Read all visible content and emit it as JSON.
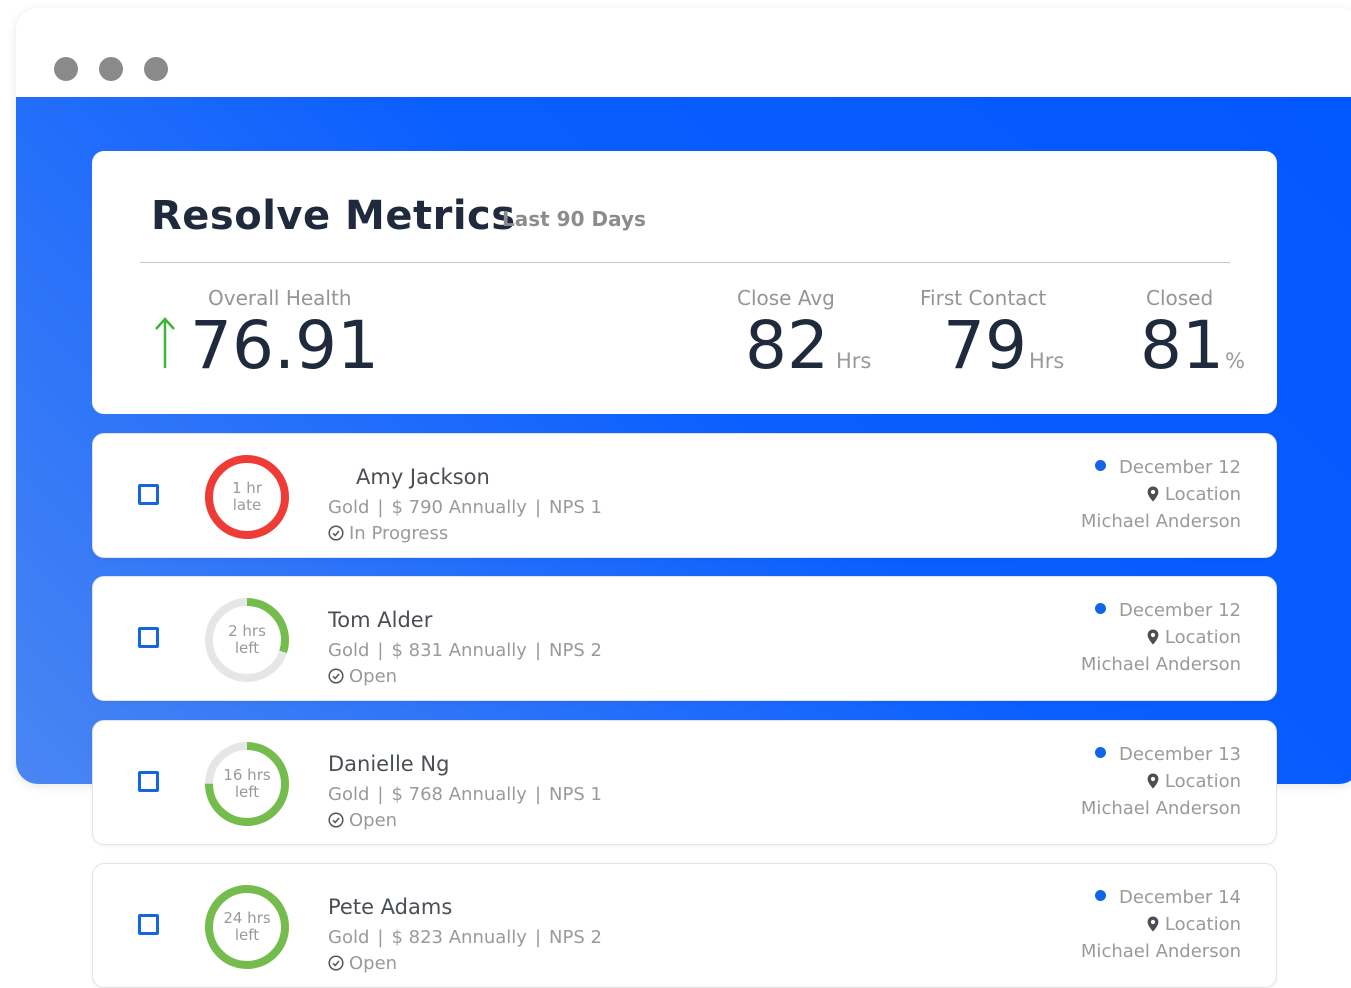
{
  "window": {
    "controls": [
      "window-control-dot",
      "window-control-dot",
      "window-control-dot"
    ]
  },
  "metrics": {
    "title": "Resolve Metrics",
    "range": "Last 90 Days",
    "overall_health": {
      "label": "Overall Health",
      "value": "76.91",
      "trend": "up",
      "trend_color": "#3ab53a"
    },
    "close_avg": {
      "label": "Close Avg",
      "value": "82",
      "unit": "Hrs"
    },
    "first_contact": {
      "label": "First Contact",
      "value": "79",
      "unit": "Hrs"
    },
    "closed": {
      "label": "Closed",
      "value": "81",
      "unit": "%"
    }
  },
  "tickets": [
    {
      "name": "Amy Jackson",
      "tier": "Gold",
      "amount": "$ 790 Annually",
      "nps": "NPS 1",
      "status": "In Progress",
      "timer_line1": "1 hr",
      "timer_line2": "late",
      "timer_progress": 1.0,
      "ring_color": "#ef3b36",
      "date": "December 12",
      "location": "Location",
      "owner": "Michael Anderson"
    },
    {
      "name": "Tom Alder",
      "tier": "Gold",
      "amount": "$ 831 Annually",
      "nps": "NPS 2",
      "status": "Open",
      "timer_line1": "2 hrs",
      "timer_line2": "left",
      "timer_progress": 0.3,
      "ring_color": "#74bc4b",
      "date": "December 12",
      "location": "Location",
      "owner": "Michael Anderson"
    },
    {
      "name": "Danielle Ng",
      "tier": "Gold",
      "amount": "$ 768 Annually",
      "nps": "NPS 1",
      "status": "Open",
      "timer_line1": "16 hrs",
      "timer_line2": "left",
      "timer_progress": 0.75,
      "ring_color": "#74bc4b",
      "date": "December 13",
      "location": "Location",
      "owner": "Michael Anderson"
    },
    {
      "name": "Pete Adams",
      "tier": "Gold",
      "amount": "$ 823 Annually",
      "nps": "NPS 2",
      "status": "Open",
      "timer_line1": "24 hrs",
      "timer_line2": "left",
      "timer_progress": 1.0,
      "ring_color": "#74bc4b",
      "date": "December 14",
      "location": "Location",
      "owner": "Michael Anderson"
    }
  ],
  "colors": {
    "accent_blue": "#0a5eff",
    "checkbox_blue": "#1464e6",
    "ring_track": "#e6e6e6",
    "late_red": "#ef3b36",
    "ok_green": "#74bc4b"
  }
}
